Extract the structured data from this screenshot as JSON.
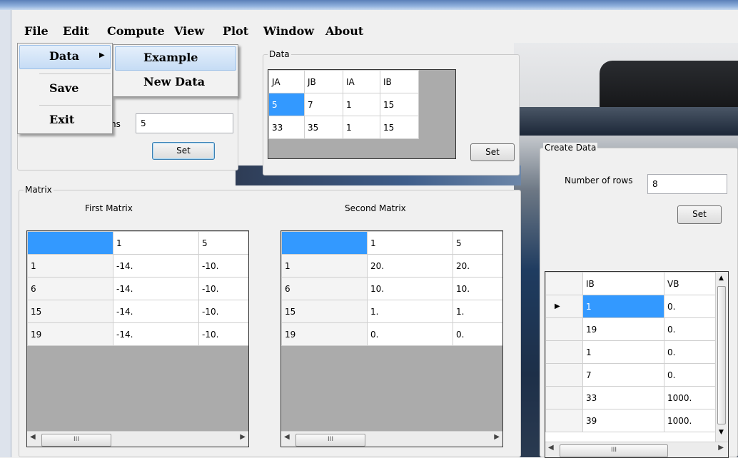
{
  "menubar": {
    "file": "File",
    "edit": "Edit",
    "compute": "Compute",
    "view": "View",
    "plot": "Plot",
    "window": "Window",
    "about": "About"
  },
  "file_menu": {
    "data": "Data",
    "save": "Save",
    "exit": "Exit",
    "arrow": "▶"
  },
  "data_submenu": {
    "example": "Example",
    "new_data": "New Data"
  },
  "columns_panel": {
    "label_fragment": "ns",
    "value": "5",
    "set": "Set"
  },
  "data_panel": {
    "legend": "Data",
    "headers": [
      "JA",
      "JB",
      "IA",
      "IB"
    ],
    "rows": [
      [
        "5",
        "7",
        "1",
        "15"
      ],
      [
        "33",
        "35",
        "1",
        "15"
      ]
    ],
    "set": "Set"
  },
  "matrix_panel": {
    "legend": "Matrix",
    "first_title": "First Matrix",
    "second_title": "Second Matrix",
    "first": {
      "headers": [
        "",
        "1",
        "5"
      ],
      "rows": [
        [
          "1",
          "-14.",
          "-10."
        ],
        [
          "6",
          "-14.",
          "-10."
        ],
        [
          "15",
          "-14.",
          "-10."
        ],
        [
          "19",
          "-14.",
          "-10."
        ]
      ]
    },
    "second": {
      "headers": [
        "",
        "1",
        "5"
      ],
      "rows": [
        [
          "1",
          "20.",
          "20."
        ],
        [
          "6",
          "10.",
          "10."
        ],
        [
          "15",
          "1.",
          "1."
        ],
        [
          "19",
          "0.",
          "0."
        ]
      ]
    }
  },
  "create_panel": {
    "legend": "Create Data",
    "rows_label": "Number of rows",
    "rows_value": "8",
    "set": "Set",
    "headers": [
      "IB",
      "VB"
    ],
    "rows": [
      [
        "1",
        "0."
      ],
      [
        "19",
        "0."
      ],
      [
        "1",
        "0."
      ],
      [
        "7",
        "0."
      ],
      [
        "33",
        "1000."
      ],
      [
        "39",
        "1000."
      ]
    ],
    "current_row_marker": "▶"
  },
  "scroll": {
    "left": "◀",
    "right": "▶",
    "up": "▲",
    "down": "▼",
    "thumb": "III"
  }
}
